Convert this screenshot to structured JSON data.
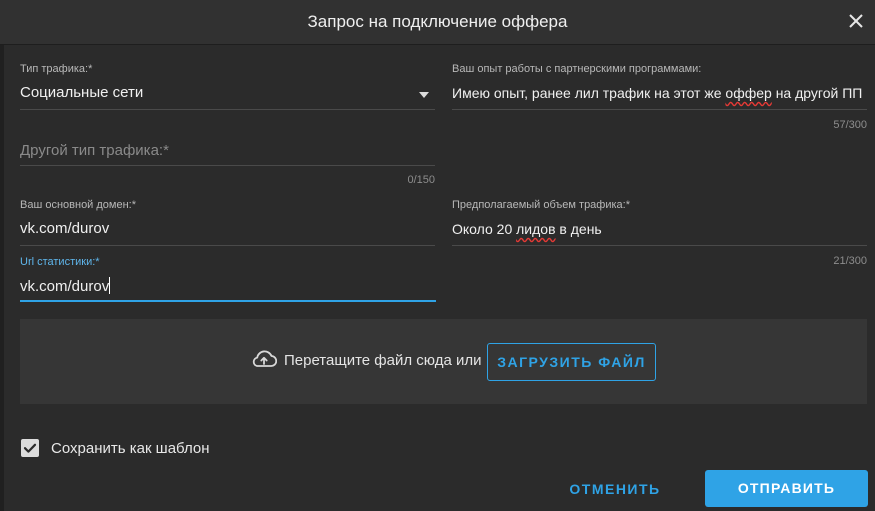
{
  "dialog": {
    "title": "Запрос на подключение оффера",
    "close_icon": "close-icon"
  },
  "form": {
    "traffic_type": {
      "label": "Тип трафика:*",
      "value": "Социальные сети",
      "icon": "dropdown-arrow-icon"
    },
    "other_traffic": {
      "placeholder": "Другой тип трафика:*",
      "counter": "0/150"
    },
    "experience": {
      "label": "Ваш опыт работы с партнерскими программами:",
      "value_before": "Имею опыт, ранее лил трафик на этот же ",
      "value_misspelled": "оффер",
      "value_after": " на другой ПП",
      "counter": "57/300"
    },
    "main_domain": {
      "label": "Ваш основной домен:*",
      "value": "vk.com/durov"
    },
    "traffic_volume": {
      "label": "Предполагаемый объем трафика:*",
      "value_before": "Около 20 ",
      "value_misspelled": "лидов",
      "value_after": " в день",
      "counter": "21/300"
    },
    "stats_url": {
      "label": "Url статистики:*",
      "value": "vk.com/durov"
    }
  },
  "upload": {
    "icon": "cloud-upload-icon",
    "text": "Перетащите файл сюда или",
    "button_label": "ЗАГРУЗИТЬ ФАЙЛ"
  },
  "template": {
    "checked": true,
    "label": "Сохранить как шаблон"
  },
  "actions": {
    "cancel_label": "ОТМЕНИТЬ",
    "submit_label": "ОТПРАВИТЬ"
  },
  "colors": {
    "accent": "#2fa3e6",
    "background": "#2b2b2b",
    "header": "#313131",
    "upload_zone": "#363636"
  }
}
